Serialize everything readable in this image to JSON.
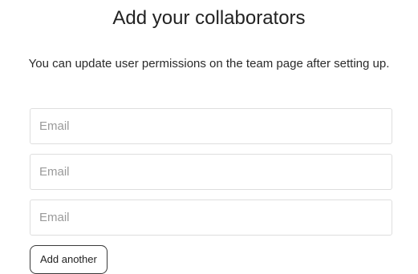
{
  "page": {
    "title": "Add your collaborators",
    "subtitle": "You can update user permissions on the team page after setting up."
  },
  "form": {
    "email_fields": [
      {
        "placeholder": "Email",
        "value": ""
      },
      {
        "placeholder": "Email",
        "value": ""
      },
      {
        "placeholder": "Email",
        "value": ""
      }
    ],
    "add_another_label": "Add another"
  }
}
